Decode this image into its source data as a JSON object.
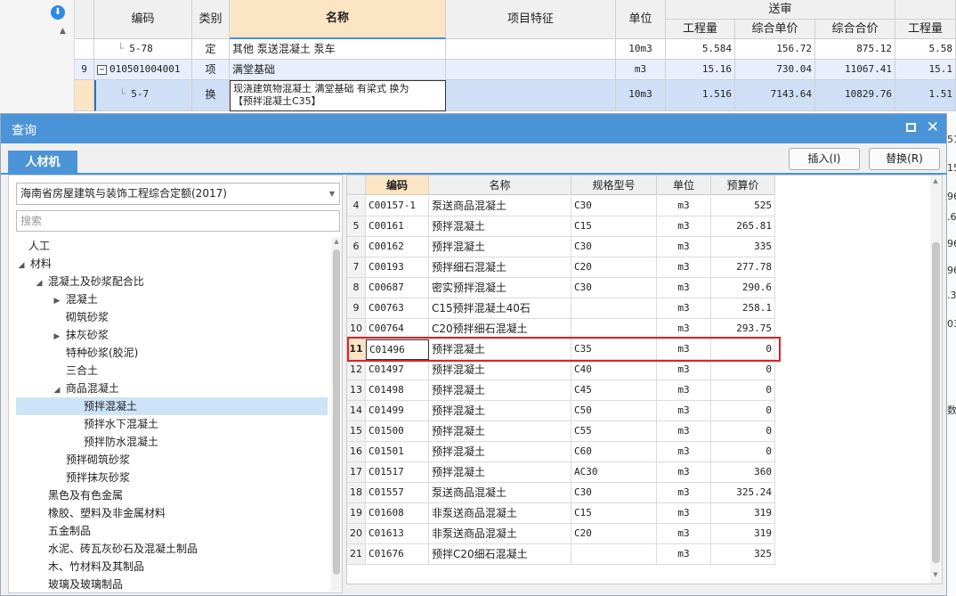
{
  "background": {
    "left_panel": {
      "download_icon": "download-icon",
      "scroll_arrow": "▲"
    },
    "headers": {
      "code": "编码",
      "category": "类别",
      "name": "名称",
      "feature": "项目特征",
      "unit": "单位",
      "group": "送审",
      "quantity": "工程量",
      "unit_price": "综合单价",
      "total_price": "综合合价",
      "quantity2": "工程量"
    },
    "rows": [
      {
        "idx": "",
        "code": "5-78",
        "category": "定",
        "name": "其他 泵送混凝土 泵车",
        "unit": "10m3",
        "quantity": "5.584",
        "unit_price": "156.72",
        "total_price": "875.12",
        "quantity2": "5.58"
      },
      {
        "idx": "9",
        "code": "010501004001",
        "category": "项",
        "name": "满堂基础",
        "unit": "m3",
        "quantity": "15.16",
        "unit_price": "730.04",
        "total_price": "11067.41",
        "quantity2": "15.1"
      },
      {
        "idx": "",
        "code": "5-7",
        "category": "换",
        "name_line1": "现浇建筑物混凝土 满堂基础 有梁式  换为",
        "name_line2": "【预拌混凝土C35】",
        "unit": "10m3",
        "quantity": "1.516",
        "unit_price": "7143.64",
        "total_price": "10829.76",
        "quantity2": "1.51"
      }
    ],
    "right_strip": [
      "51",
      "15",
      "96",
      ".6",
      "96",
      "96",
      ".3",
      "03",
      "数"
    ]
  },
  "dialog": {
    "title": "查询",
    "tab": "人材机",
    "insert_label": "插入(I)",
    "replace_label": "替换(R)",
    "quota_select": "海南省房屋建筑与装饰工程综合定额(2017)",
    "search_placeholder": "搜索",
    "tree": [
      {
        "label": "人工",
        "arrow": ""
      },
      {
        "label": "材料",
        "arrow": "◢"
      },
      {
        "label": "混凝土及砂浆配合比",
        "arrow": "◢"
      },
      {
        "label": "混凝土",
        "arrow": "▶"
      },
      {
        "label": "砌筑砂浆",
        "arrow": ""
      },
      {
        "label": "抹灰砂浆",
        "arrow": "▶"
      },
      {
        "label": "特种砂浆(胶泥)",
        "arrow": ""
      },
      {
        "label": "三合土",
        "arrow": ""
      },
      {
        "label": "商品混凝土",
        "arrow": "◢"
      },
      {
        "label": "预拌混凝土",
        "arrow": ""
      },
      {
        "label": "预拌水下混凝土",
        "arrow": ""
      },
      {
        "label": "预拌防水混凝土",
        "arrow": ""
      },
      {
        "label": "预拌砌筑砂浆",
        "arrow": ""
      },
      {
        "label": "预拌抹灰砂浆",
        "arrow": ""
      },
      {
        "label": "黑色及有色金属",
        "arrow": ""
      },
      {
        "label": "橡胶、塑料及非金属材料",
        "arrow": ""
      },
      {
        "label": "五金制品",
        "arrow": ""
      },
      {
        "label": "水泥、砖瓦灰砂石及混凝土制品",
        "arrow": ""
      },
      {
        "label": "木、竹材料及其制品",
        "arrow": ""
      },
      {
        "label": "玻璃及玻璃制品",
        "arrow": ""
      }
    ],
    "table": {
      "headers": {
        "code": "编码",
        "name": "名称",
        "spec": "规格型号",
        "unit": "单位",
        "price": "预算价"
      },
      "rows": [
        {
          "idx": "4",
          "code": "C00157-1",
          "name": "泵送商品混凝土",
          "spec": "C30",
          "unit": "m3",
          "price": "525"
        },
        {
          "idx": "5",
          "code": "C00161",
          "name": "预拌混凝土",
          "spec": "C15",
          "unit": "m3",
          "price": "265.81"
        },
        {
          "idx": "6",
          "code": "C00162",
          "name": "预拌混凝土",
          "spec": "C30",
          "unit": "m3",
          "price": "335"
        },
        {
          "idx": "7",
          "code": "C00193",
          "name": "预拌细石混凝土",
          "spec": "C20",
          "unit": "m3",
          "price": "277.78"
        },
        {
          "idx": "8",
          "code": "C00687",
          "name": "密实预拌混凝土",
          "spec": "C30",
          "unit": "m3",
          "price": "290.6"
        },
        {
          "idx": "9",
          "code": "C00763",
          "name": "C15预拌混凝土40石",
          "spec": "",
          "unit": "m3",
          "price": "258.1"
        },
        {
          "idx": "10",
          "code": "C00764",
          "name": "C20预拌细石混凝土",
          "spec": "",
          "unit": "m3",
          "price": "293.75"
        },
        {
          "idx": "11",
          "code": "C01496",
          "name": "预拌混凝土",
          "spec": "C35",
          "unit": "m3",
          "price": "0"
        },
        {
          "idx": "12",
          "code": "C01497",
          "name": "预拌混凝土",
          "spec": "C40",
          "unit": "m3",
          "price": "0"
        },
        {
          "idx": "13",
          "code": "C01498",
          "name": "预拌混凝土",
          "spec": "C45",
          "unit": "m3",
          "price": "0"
        },
        {
          "idx": "14",
          "code": "C01499",
          "name": "预拌混凝土",
          "spec": "C50",
          "unit": "m3",
          "price": "0"
        },
        {
          "idx": "15",
          "code": "C01500",
          "name": "预拌混凝土",
          "spec": "C55",
          "unit": "m3",
          "price": "0"
        },
        {
          "idx": "16",
          "code": "C01501",
          "name": "预拌混凝土",
          "spec": "C60",
          "unit": "m3",
          "price": "0"
        },
        {
          "idx": "17",
          "code": "C01517",
          "name": "预拌混凝土",
          "spec": "AC30",
          "unit": "m3",
          "price": "360"
        },
        {
          "idx": "18",
          "code": "C01557",
          "name": "泵送商品混凝土",
          "spec": "C30",
          "unit": "m3",
          "price": "325.24"
        },
        {
          "idx": "19",
          "code": "C01608",
          "name": "非泵送商品混凝土",
          "spec": "C15",
          "unit": "m3",
          "price": "319"
        },
        {
          "idx": "20",
          "code": "C01613",
          "name": "非泵送商品混凝土",
          "spec": "C20",
          "unit": "m3",
          "price": "319"
        },
        {
          "idx": "21",
          "code": "C01676",
          "name": "预拌C20细石混凝土",
          "spec": "",
          "unit": "m3",
          "price": "325"
        }
      ]
    }
  },
  "colors": {
    "accent": "#4c94d8",
    "highlight": "#e0202a",
    "selected_header": "#fce5c4",
    "selected_tree": "#cde3f8"
  }
}
